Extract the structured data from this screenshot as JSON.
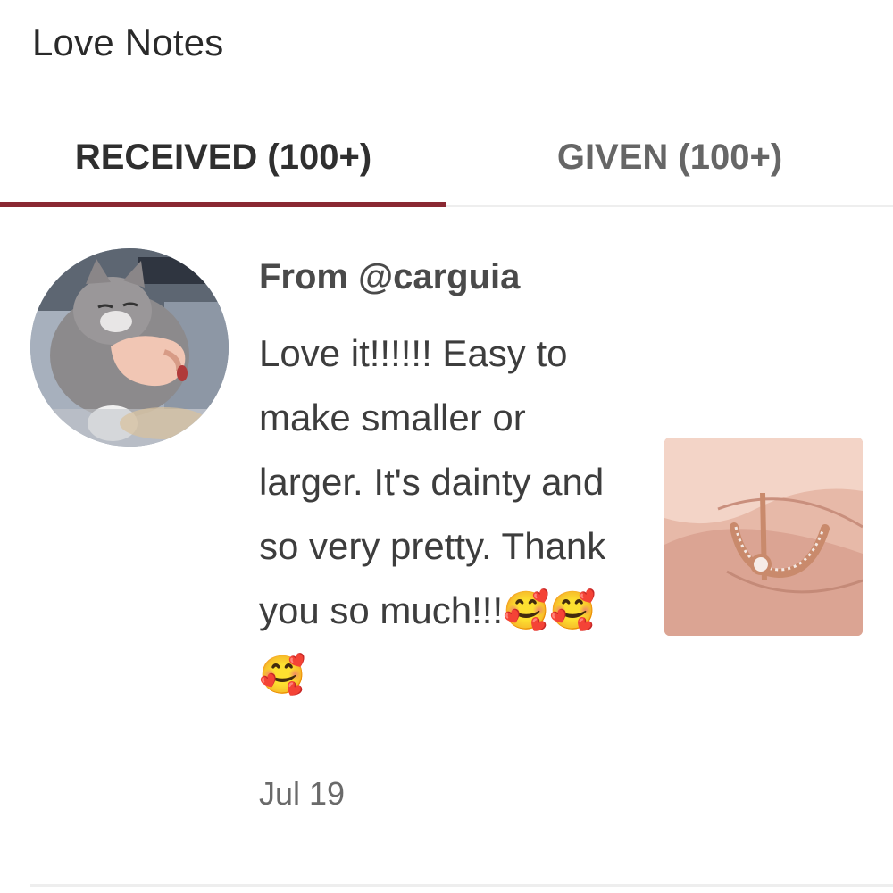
{
  "header": {
    "title": "Love Notes"
  },
  "tabs": [
    {
      "label": "RECEIVED (100+)",
      "active": true
    },
    {
      "label": "GIVEN (100+)",
      "active": false
    }
  ],
  "note": {
    "from": "From @carguia",
    "message": "Love it!!!!!! Easy to make smaller or larger. It's dainty and so very pretty. Thank you so much!!!🥰🥰🥰",
    "date": "Jul 19",
    "avatar_icon": "cat-photo",
    "product_image": "rose-gold-moon-ring-photo"
  },
  "colors": {
    "tab_accent": "#8a2832",
    "active_tab_text": "#2f2f2f",
    "inactive_tab_text": "#666666"
  }
}
